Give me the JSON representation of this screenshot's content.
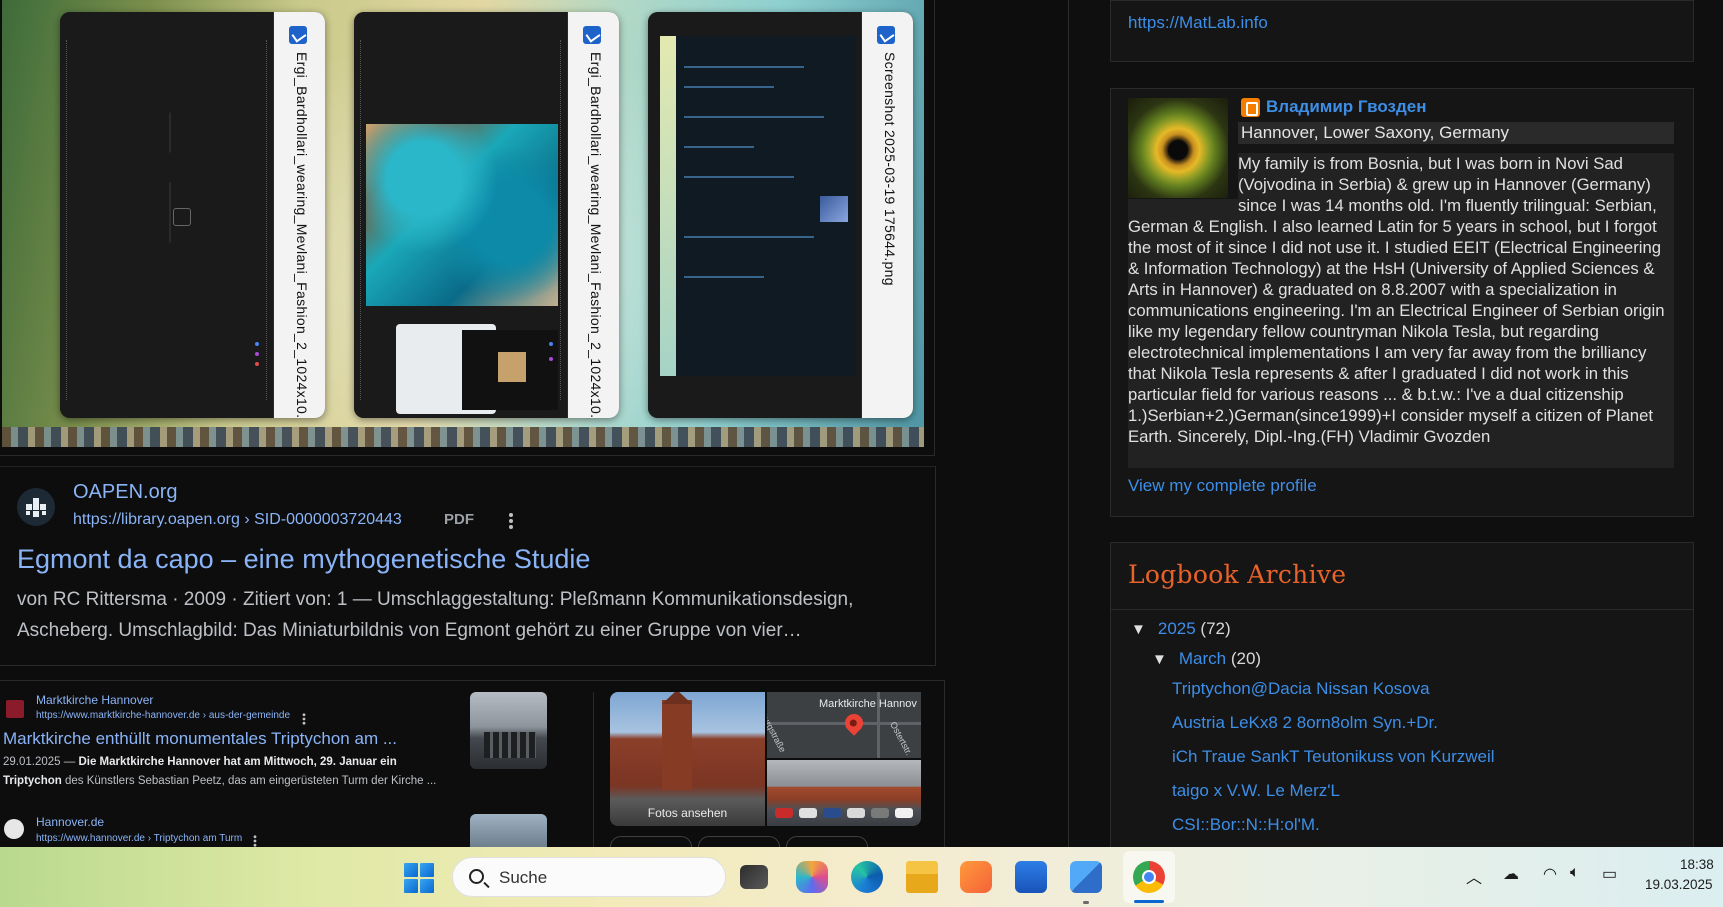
{
  "thumbnails": [
    {
      "filename": "Ergi_Bardhollari_wearing_Mevlani_Fashion_2_1024x10..."
    },
    {
      "filename": "Ergi_Bardhollari_wearing_Mevlani_Fashion_2_1024x10..."
    },
    {
      "filename": "Screenshot 2025-03-19 175644.png"
    }
  ],
  "result_oapen": {
    "site": "OAPEN.org",
    "url": "https://library.oapen.org › SID-0000003720443",
    "tag": "PDF",
    "title": "Egmont da capo – eine mythogenetische Studie",
    "snippet": "von RC Rittersma · 2009 · Zitiert von: 1 — Umschlaggestaltung: Pleßmann Kommunikationsdesign, Ascheberg. Umschlagbild: Das Miniaturbildnis von Egmont gehört zu einer Gruppe von vier…"
  },
  "result_marktkirche": {
    "site": "Marktkirche Hannover",
    "url": "https://www.marktkirche-hannover.de › aus-der-gemeinde",
    "title": "Marktkirche enthüllt monumentales Triptychon am ...",
    "snippet_date": "29.01.2025 — ",
    "snippet_bold": "Die Marktkirche Hannover hat am Mittwoch, 29. Januar ein Triptychon",
    "snippet_rest": " des Künstlers Sebastian Peetz, das am eingerüsteten Turm der Kirche ..."
  },
  "result_hannover": {
    "site": "Hannover.de",
    "url": "https://www.hannover.de › Triptychon am Turm"
  },
  "knowledge_panel": {
    "photo_caption": "Fotos ansehen",
    "map_label": "Marktkirche Hannov",
    "street1": "Burgstraße",
    "street2": "Ostertstr."
  },
  "sidebar": {
    "top_link": "https://MatLab.info",
    "profile": {
      "name": "Владимир Гвозден",
      "location": "Hannover, Lower Saxony, Germany",
      "bio": "My family is from Bosnia, but I was born in Novi Sad (Vojvodina in Serbia) & grew up in Hannover (Germany) since I was 14 months old. I'm fluently trilingual: Serbian, German & English. I also learned Latin for 5 years in school, but I forgot the most of it since I did not use it. I studied EEIT (Electrical Engineering & Information Technology) at the HsH (University of Applied Sciences & Arts in Hannover) & graduated on 8.8.2007 with a specialization in communications engineering. I'm an Electrical Engineer of Serbian origin like my legendary fellow countryman Nikola Tesla, but regarding electrotechnical implementations I am very far away from the brilliancy that Nikola Tesla represents & after I graduated I did not work in this particular field for various reasons ... & b.t.w.: I've a dual citizenship 1.)Serbian+2.)German(since1999)+I consider myself a citizen of Planet Earth. Sincerely, Dipl.-Ing.(FH) Vladimir Gvozden",
      "link": "View my complete profile"
    },
    "archive": {
      "title": "Logbook Archive",
      "year": {
        "label": "2025",
        "count": "(72)"
      },
      "month": {
        "label": "March",
        "count": "(20)"
      },
      "posts": [
        "Triptychon@Dacia Nissan Kosova",
        "Austria LeKx8 2 8orn8olm Syn.+Dr.",
        "iCh Traue SankT Teutonikuss von Kurzweil",
        "taigo x V.W. Le Merz'L",
        "CSI::Bor::N::H:ol'M."
      ]
    }
  },
  "taskbar": {
    "search_text": "Suche",
    "time": "18:38",
    "date": "19.03.2025"
  },
  "colors": {
    "link": "#3d8ee7",
    "google_link": "#8ab4f8",
    "archive_title": "#e8622a"
  }
}
